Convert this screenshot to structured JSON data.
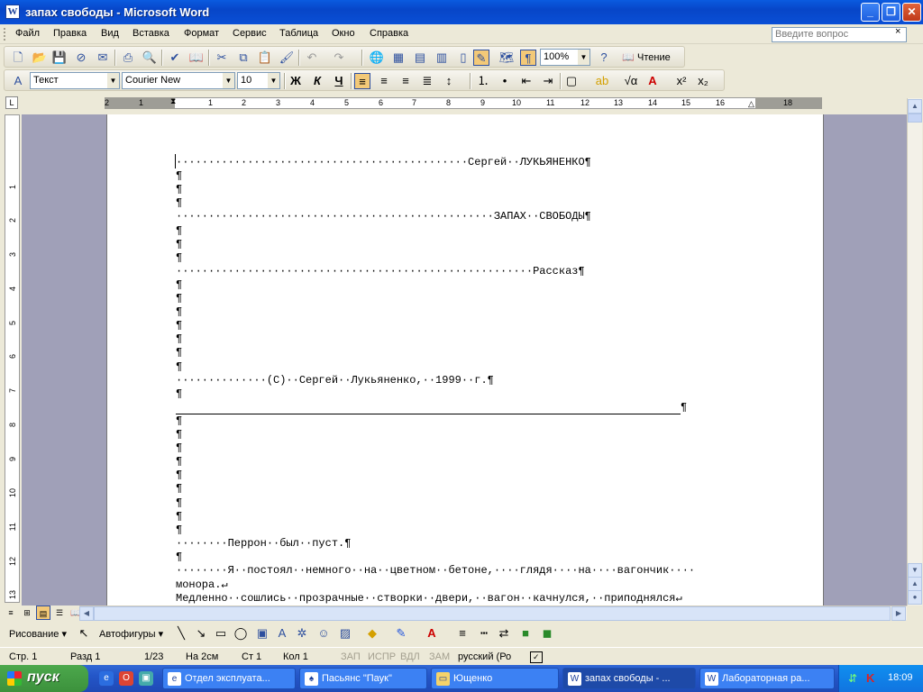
{
  "window": {
    "title": "запах свободы - Microsoft Word"
  },
  "menu": [
    "Файл",
    "Правка",
    "Вид",
    "Вставка",
    "Формат",
    "Сервис",
    "Таблица",
    "Окно",
    "Справка"
  ],
  "help_placeholder": "Введите вопрос",
  "standard_toolbar": {
    "zoom": "100%",
    "read_label": "Чтение"
  },
  "format_toolbar": {
    "style": "Текст",
    "font": "Courier New",
    "size": "10"
  },
  "ruler_h": [
    "2",
    "1",
    "1",
    "2",
    "3",
    "4",
    "5",
    "6",
    "7",
    "8",
    "9",
    "10",
    "11",
    "12",
    "13",
    "14",
    "15",
    "16",
    "18"
  ],
  "ruler_v": [
    "1",
    "2",
    "3",
    "4",
    "5",
    "6",
    "7",
    "8",
    "9",
    "10",
    "11",
    "12",
    "13"
  ],
  "document_lines": [
    "·············································Сергей··ЛУКЬЯНЕНКО¶",
    "¶",
    "¶",
    "¶",
    "·················································ЗАПАХ··СВОБОДЫ¶",
    "¶",
    "¶",
    "¶",
    "·······················································Рассказ¶",
    "¶",
    "¶",
    "¶",
    "¶",
    "¶",
    "¶",
    "¶",
    "··············(C)··Сергей··Лукьяненко,··1999··г.¶",
    "¶",
    "",
    "¶",
    "¶",
    "¶",
    "¶",
    "¶",
    "¶",
    "¶",
    "¶",
    "¶",
    "········Перрон··был··пуст.¶",
    "¶",
    "········Я··постоял··немного··на··цветном··бетоне,····глядя····на····вагончик····",
    "монора.↵",
    "Медленно··сошлись··прозрачные··створки··двери,··вагон··качнулся,··приподнялся↵"
  ],
  "hrule_pilcrow": "¶",
  "drawing_toolbar": {
    "draw": "Рисование",
    "autoshapes": "Автофигуры"
  },
  "status": {
    "page": "Стр. 1",
    "section": "Разд 1",
    "pages": "1/23",
    "at": "На 2см",
    "line": "Ст 1",
    "col": "Кол 1",
    "rec": "ЗАП",
    "trk": "ИСПР",
    "ext": "ВДЛ",
    "ovr": "ЗАМ",
    "lang": "русский (Ро"
  },
  "taskbar": {
    "start": "пуск",
    "tasks": [
      "Отдел эксплуата...",
      "Пасьянс \"Паук\"",
      "Ющенко",
      "запах свободы - ...",
      "Лабораторная ра..."
    ],
    "clock": "18:09"
  }
}
